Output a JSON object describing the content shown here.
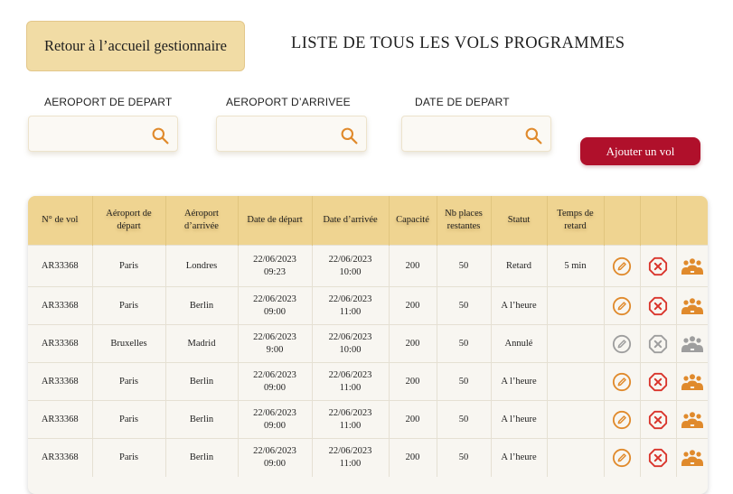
{
  "header": {
    "back_button": "Retour à l’accueil gestionnaire",
    "title": "LISTE DE TOUS LES VOLS PROGRAMMES"
  },
  "filters": [
    {
      "label": "AEROPORT DE DEPART",
      "value": "",
      "placeholder": ""
    },
    {
      "label": "AEROPORT D’ARRIVEE",
      "value": "",
      "placeholder": ""
    },
    {
      "label": "DATE DE DEPART",
      "value": "",
      "placeholder": ""
    }
  ],
  "add_button": "Ajouter un vol",
  "table": {
    "headers": [
      "N° de vol",
      "Aéroport de départ",
      "Aéroport d’arrivée",
      "Date de départ",
      "Date d’arrivée",
      "Capacité",
      "Nb places restantes",
      "Statut",
      "Temps de retard"
    ],
    "rows": [
      {
        "num": "AR33368",
        "from": "Paris",
        "to": "Londres",
        "dep_date": "22/06/2023",
        "dep_time": "09:23",
        "arr_date": "22/06/2023",
        "arr_time": "10:00",
        "capacity": "200",
        "remaining": "50",
        "status": "Retard",
        "delay": "5 min",
        "active": true
      },
      {
        "num": "AR33368",
        "from": "Paris",
        "to": "Berlin",
        "dep_date": "22/06/2023",
        "dep_time": "09:00",
        "arr_date": "22/06/2023",
        "arr_time": "11:00",
        "capacity": "200",
        "remaining": "50",
        "status": "A l’heure",
        "delay": "",
        "active": true
      },
      {
        "num": "AR33368",
        "from": "Bruxelles",
        "to": "Madrid",
        "dep_date": "22/06/2023",
        "dep_time": "9:00",
        "arr_date": "22/06/2023",
        "arr_time": "10:00",
        "capacity": "200",
        "remaining": "50",
        "status": "Annulé",
        "delay": "",
        "active": false
      },
      {
        "num": "AR33368",
        "from": "Paris",
        "to": "Berlin",
        "dep_date": "22/06/2023",
        "dep_time": "09:00",
        "arr_date": "22/06/2023",
        "arr_time": "11:00",
        "capacity": "200",
        "remaining": "50",
        "status": "A l’heure",
        "delay": "",
        "active": true
      },
      {
        "num": "AR33368",
        "from": "Paris",
        "to": "Berlin",
        "dep_date": "22/06/2023",
        "dep_time": "09:00",
        "arr_date": "22/06/2023",
        "arr_time": "11:00",
        "capacity": "200",
        "remaining": "50",
        "status": "A l’heure",
        "delay": "",
        "active": true
      },
      {
        "num": "AR33368",
        "from": "Paris",
        "to": "Berlin",
        "dep_date": "22/06/2023",
        "dep_time": "09:00",
        "arr_date": "22/06/2023",
        "arr_time": "11:00",
        "capacity": "200",
        "remaining": "50",
        "status": "A l’heure",
        "delay": "",
        "active": true
      }
    ]
  },
  "icons": {
    "search": "search-icon",
    "edit": "pencil-icon",
    "cancel": "cancel-x-icon",
    "passengers": "passengers-group-icon"
  },
  "colors": {
    "header_bg": "#efd491",
    "back_button_bg": "#f1dca5",
    "add_button_bg": "#b0102b",
    "edit_icon": "#e08a2c",
    "cancel_icon": "#d9342b",
    "passengers_icon": "#e08a2c",
    "disabled_icon": "#9e9e9e"
  }
}
